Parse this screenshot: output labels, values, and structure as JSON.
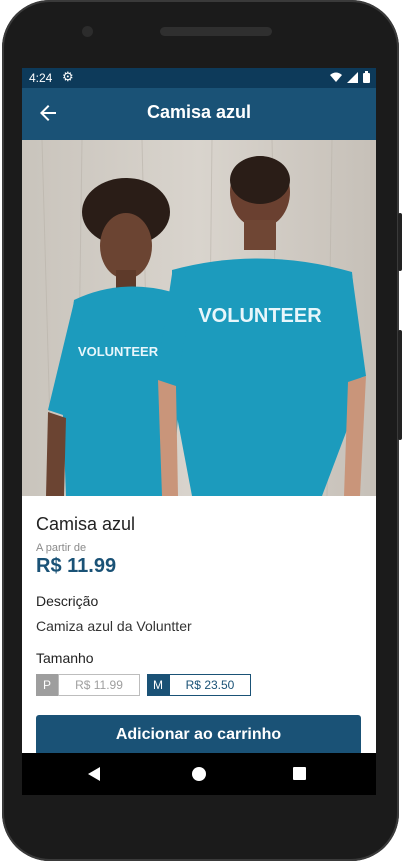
{
  "status_bar": {
    "time": "4:24",
    "icons": [
      "gear-icon",
      "wifi-icon",
      "signal-icon",
      "battery-icon"
    ]
  },
  "app_bar": {
    "title": "Camisa azul",
    "back_icon": "arrow-left-icon"
  },
  "hero_image": {
    "shirt_text": "VOLUNTEER"
  },
  "product": {
    "name": "Camisa azul",
    "from_label": "A partir de",
    "price": "R$ 11.99",
    "description_label": "Descrição",
    "description": "Camiza azul da Voluntter",
    "size_label": "Tamanho",
    "sizes": [
      {
        "letter": "P",
        "price": "R$ 11.99",
        "selected": false
      },
      {
        "letter": "M",
        "price": "R$ 23.50",
        "selected": true
      }
    ],
    "add_to_cart": "Adicionar ao carrinho"
  },
  "colors": {
    "primary": "#1a5276",
    "status_bar": "#0d3a5a",
    "shirt": "#1c9bbd"
  }
}
